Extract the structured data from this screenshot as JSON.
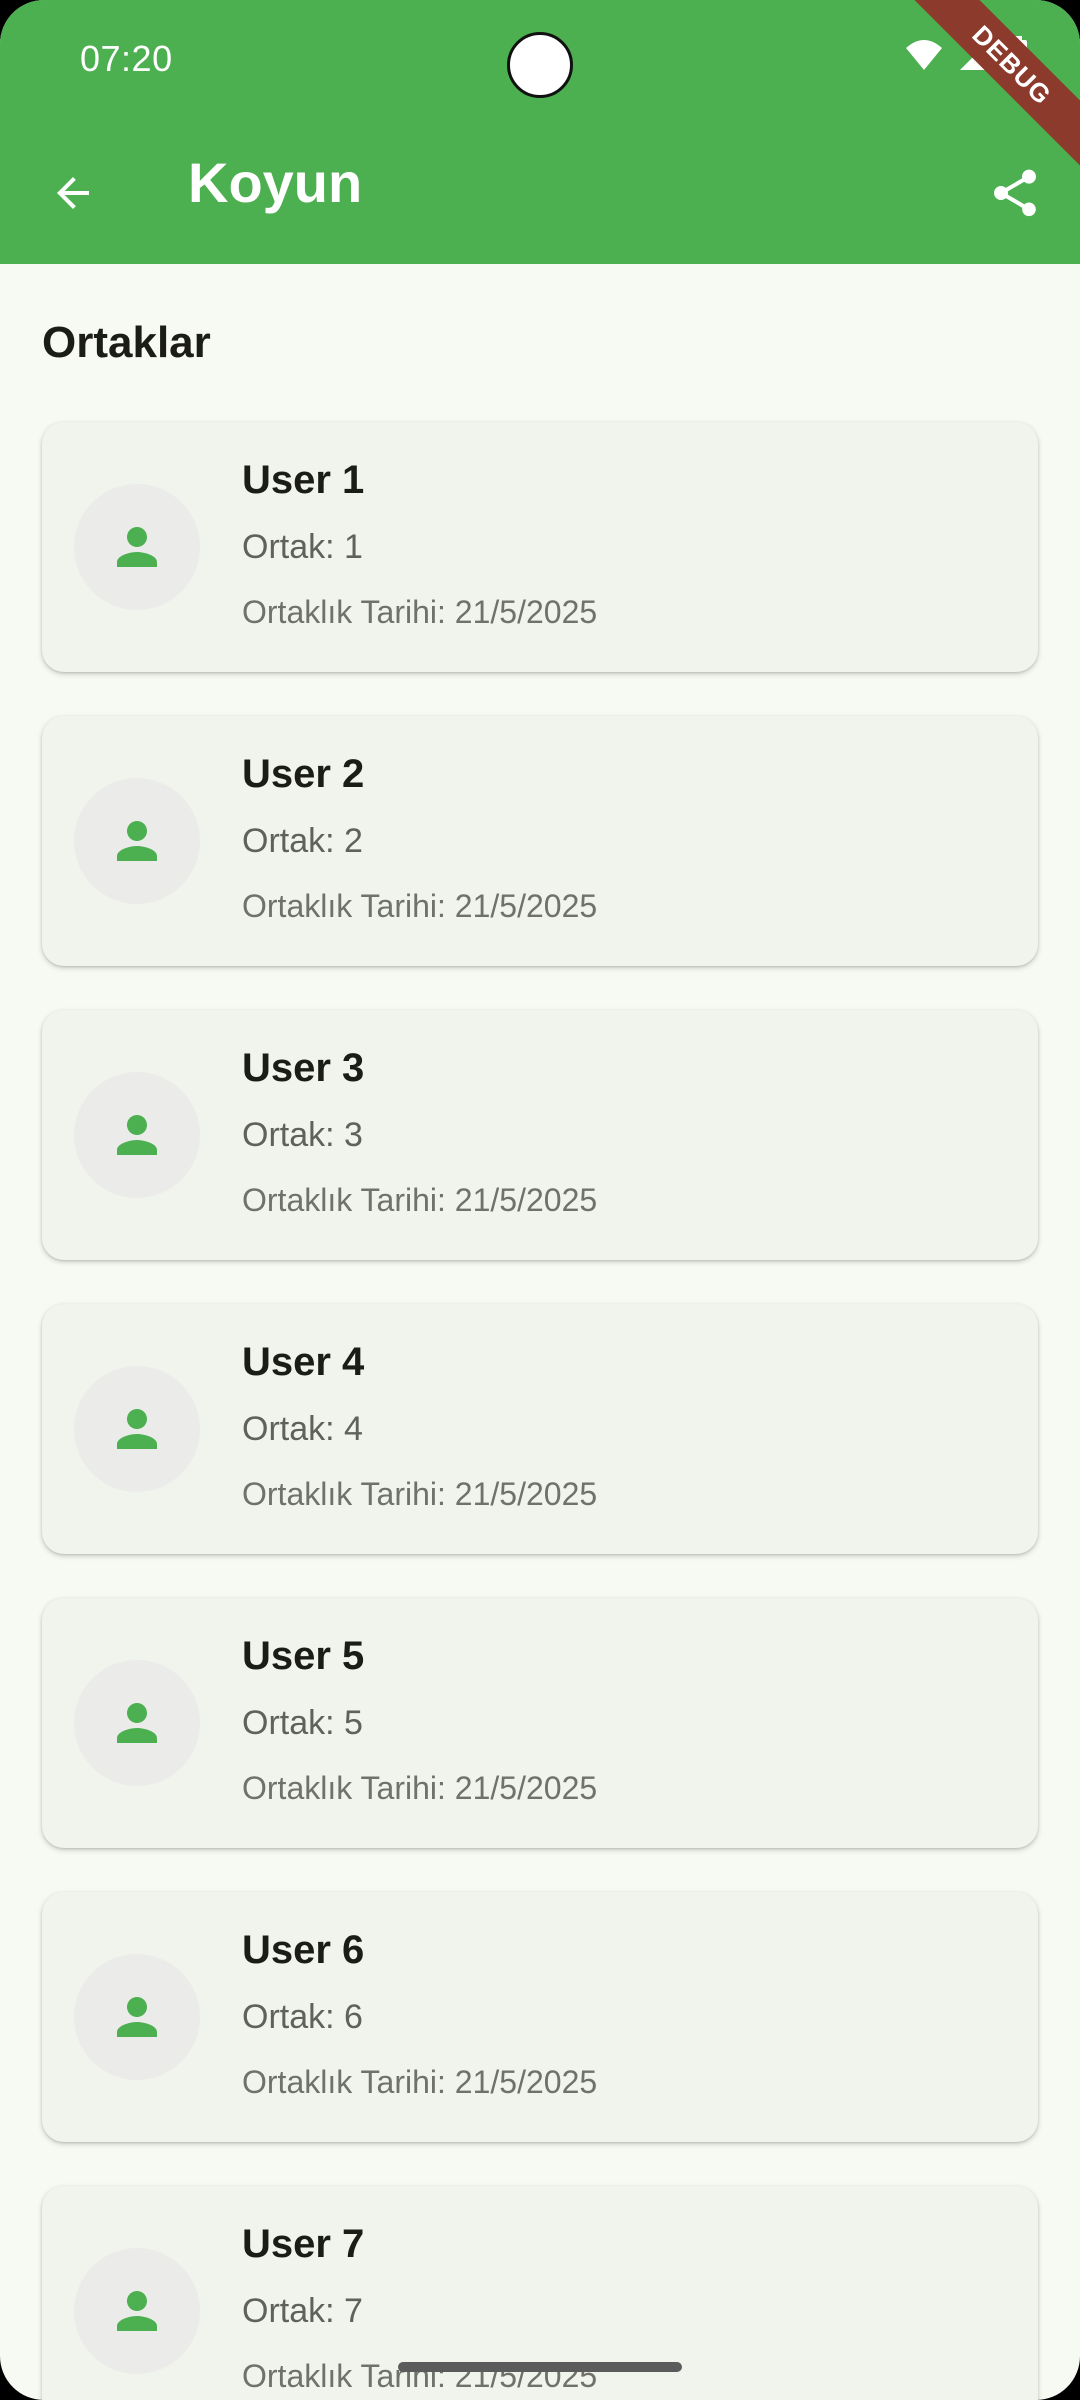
{
  "status_bar": {
    "time": "07:20"
  },
  "debug_banner": "DEBUG",
  "app_bar": {
    "title": "Koyun",
    "back_icon": "arrow-back-icon",
    "share_icon": "share-icon"
  },
  "section_title": "Ortaklar",
  "partners": [
    {
      "name": "User 1",
      "share": "Ortak: 1",
      "date": "Ortaklık Tarihi: 21/5/2025"
    },
    {
      "name": "User 2",
      "share": "Ortak: 2",
      "date": "Ortaklık Tarihi: 21/5/2025"
    },
    {
      "name": "User 3",
      "share": "Ortak: 3",
      "date": "Ortaklık Tarihi: 21/5/2025"
    },
    {
      "name": "User 4",
      "share": "Ortak: 4",
      "date": "Ortaklık Tarihi: 21/5/2025"
    },
    {
      "name": "User 5",
      "share": "Ortak: 5",
      "date": "Ortaklık Tarihi: 21/5/2025"
    },
    {
      "name": "User 6",
      "share": "Ortak: 6",
      "date": "Ortaklık Tarihi: 21/5/2025"
    },
    {
      "name": "User 7",
      "share": "Ortak: 7",
      "date": "Ortaklık Tarihi: 21/5/2025"
    }
  ],
  "colors": {
    "primary": "#4caf50",
    "background": "#f7faf3",
    "card": "#f1f4ec",
    "debug": "#8b3a2b"
  }
}
